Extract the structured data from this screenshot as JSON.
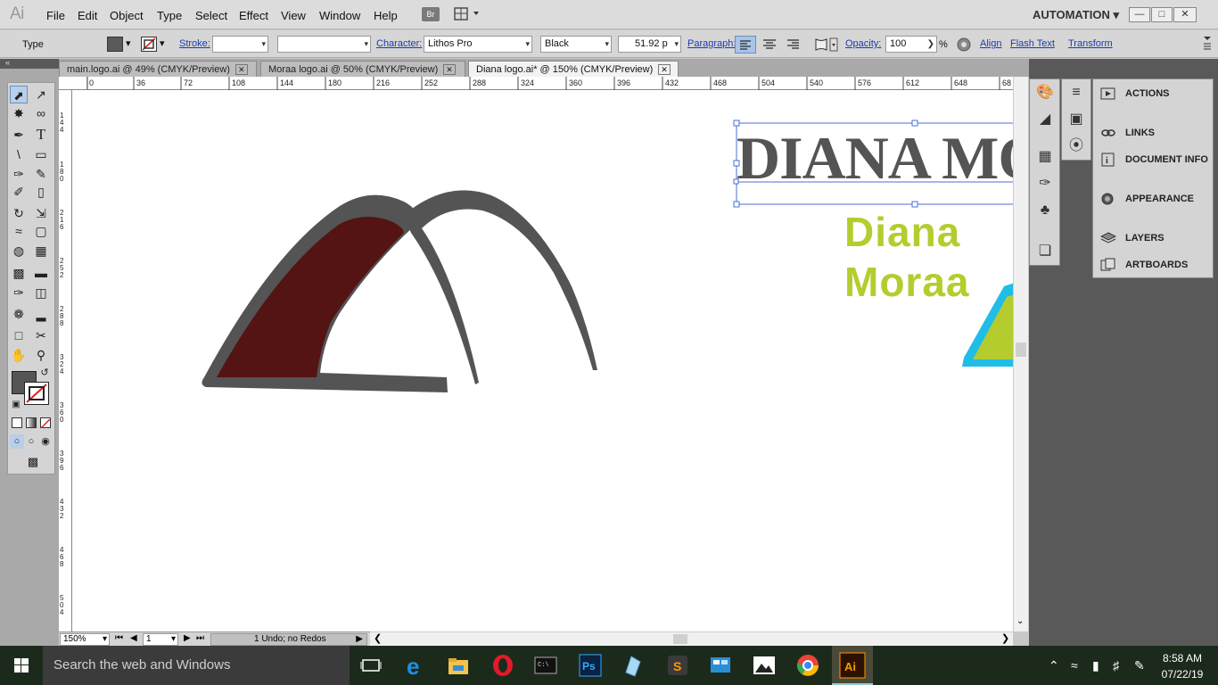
{
  "app": {
    "logo": "Ai",
    "menu": [
      "File",
      "Edit",
      "Object",
      "Type",
      "Select",
      "Effect",
      "View",
      "Window",
      "Help"
    ],
    "bridge_label": "Br",
    "workspace": "AUTOMATION"
  },
  "control": {
    "tool_label": "Type",
    "stroke_label": "Stroke:",
    "character_label": "Character:",
    "font_family": "Lithos Pro",
    "font_style": "Black",
    "font_size": "51.92 p",
    "paragraph_label": "Paragraph:",
    "opacity_label": "Opacity:",
    "opacity_value": "100",
    "percent": "%",
    "align_label": "Align",
    "flash_text_label": "Flash Text",
    "transform_label": "Transform"
  },
  "tabs": [
    {
      "label": "main.logo.ai @ 49% (CMYK/Preview)"
    },
    {
      "label": "Moraa logo.ai @ 50% (CMYK/Preview)"
    },
    {
      "label": "Diana logo.ai* @ 150% (CMYK/Preview)"
    }
  ],
  "ruler": {
    "h_ticks": [
      "0",
      "36",
      "72",
      "108",
      "144",
      "180",
      "216",
      "252",
      "288",
      "324",
      "360",
      "396",
      "432",
      "468",
      "504",
      "540",
      "576",
      "612",
      "648",
      "68"
    ],
    "v_ticks": [
      "1\n4\n4",
      "1\n8\n0",
      "2\n1\n6",
      "2\n5\n2",
      "2\n8\n8",
      "3\n2\n4",
      "3\n6\n0",
      "3\n9\n6",
      "4\n3\n2",
      "4\n6\n8",
      "5\n0\n4"
    ]
  },
  "canvas": {
    "title_text": "DIANA MOR",
    "name_line1": "Diana",
    "name_line2": "Moraa",
    "colors": {
      "arch_gray": "#545454",
      "arch_fill": "#541414",
      "green": "#b5cc2e",
      "cyan": "#1fbde8",
      "selection": "#4a6fd6"
    }
  },
  "status": {
    "zoom": "150%",
    "page": "1",
    "undo": "1 Undo; no Redos"
  },
  "panels": {
    "items": [
      "ACTIONS",
      "LINKS",
      "DOCUMENT INFO",
      "APPEARANCE",
      "LAYERS",
      "ARTBOARDS"
    ]
  },
  "taskbar": {
    "search_placeholder": "Search the web and Windows",
    "time": "8:58 AM",
    "date": "07/22/19"
  }
}
